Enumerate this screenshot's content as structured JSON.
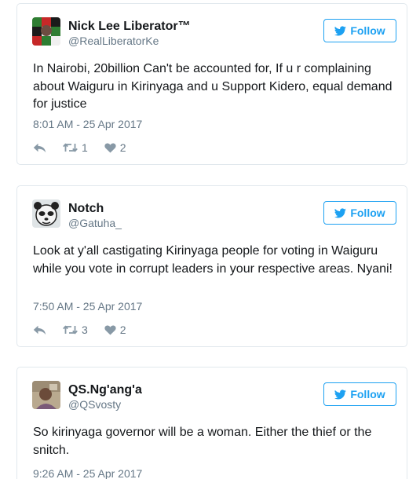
{
  "follow_label": "Follow",
  "colors": {
    "accent": "#1da1f2",
    "secondary_text": "#657786",
    "icon": "#8899a6",
    "border": "#e1e8ed"
  },
  "icons": {
    "follow": "twitter-bird-icon",
    "reply": "reply-icon",
    "retweet": "retweet-icon",
    "like": "heart-icon"
  },
  "tweets": [
    {
      "display_name": "Nick Lee Liberator™",
      "handle": "@RealLiberatorKe",
      "text": "In Nairobi, 20billion Can't be accounted for, If u r complaining about Waiguru in Kirinyaga and u Support Kidero, equal demand for justice",
      "timestamp": "8:01 AM - 25 Apr 2017",
      "retweets": "1",
      "likes": "2"
    },
    {
      "display_name": "Notch",
      "handle": "@Gatuha_",
      "text": "Look at y'all castigating Kirinyaga people for voting in Waiguru while you vote in corrupt leaders in your respective areas. Nyani!",
      "timestamp": "7:50 AM - 25 Apr 2017",
      "retweets": "3",
      "likes": "2"
    },
    {
      "display_name": "QS.Ng'ang'a",
      "handle": "@QSvosty",
      "text": "So kirinyaga governor will be a woman. Either the thief or the snitch.",
      "timestamp": "9:26 AM - 25 Apr 2017"
    }
  ]
}
